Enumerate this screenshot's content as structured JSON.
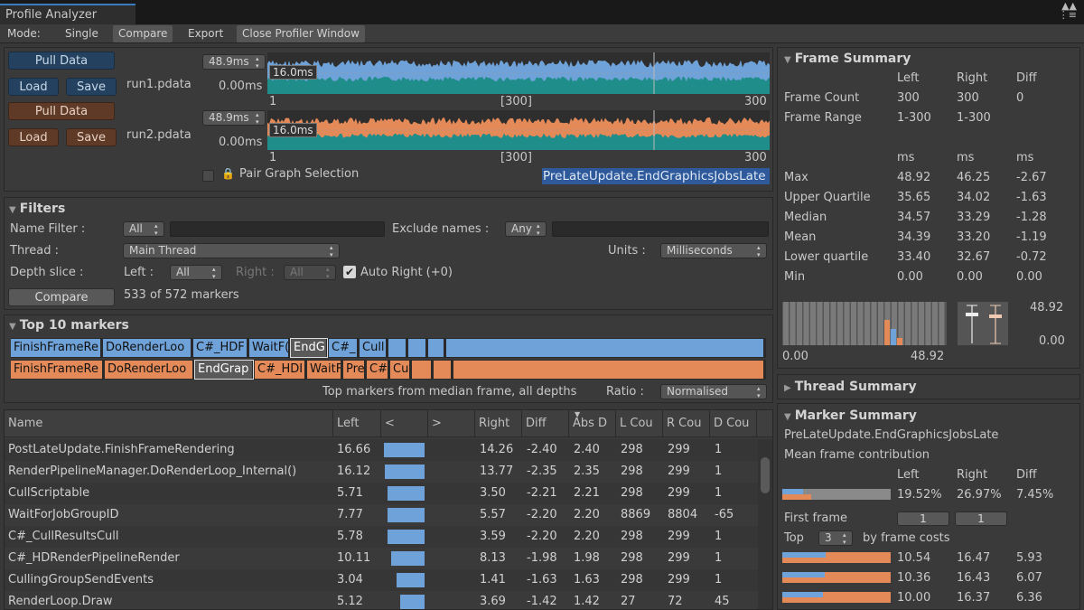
{
  "window": {
    "title": "Profile Analyzer"
  },
  "toolbar": {
    "mode_label": "Mode:",
    "single": "Single",
    "compare": "Compare",
    "export": "Export",
    "close": "Close Profiler Window"
  },
  "runs": [
    {
      "pull": "Pull Data",
      "load": "Load",
      "save": "Save",
      "name": "run1.pdata",
      "max": "48.9ms",
      "min": "0.00ms",
      "line": "16.0ms",
      "x_start": "1",
      "x_mid": "[300]",
      "x_end": "300",
      "color": "#6fa2d8"
    },
    {
      "pull": "Pull Data",
      "load": "Load",
      "save": "Save",
      "name": "run2.pdata",
      "max": "48.9ms",
      "min": "0.00ms",
      "line": "16.0ms",
      "x_start": "1",
      "x_mid": "[300]",
      "x_end": "300",
      "color": "#e38a58"
    }
  ],
  "pair_graph": "Pair Graph Selection",
  "selected_marker": "PreLateUpdate.EndGraphicsJobsLate",
  "filters": {
    "title": "Filters",
    "name_filter": "Name Filter :",
    "name_filter_value": "All",
    "exclude_names": "Exclude names :",
    "exclude_value": "Any",
    "thread": "Thread :",
    "thread_value": "Main Thread",
    "units": "Units :",
    "units_value": "Milliseconds",
    "depth": "Depth slice :",
    "left": "Left :",
    "left_value": "All",
    "right": "Right :",
    "right_value": "All",
    "auto_right": "Auto Right (+0)",
    "compare": "Compare",
    "markers_count": "533 of 572 markers"
  },
  "top10": {
    "title": "Top 10 markers",
    "row1": [
      "FinishFrameRe",
      "DoRenderLoo",
      "C#_HDF",
      "WaitF(",
      "EndG",
      "C#_",
      "Cull:",
      "",
      "",
      ""
    ],
    "row2": [
      "FinishFrameRe",
      "DoRenderLoo",
      "EndGrap",
      "C#_HDI",
      "WaitF",
      "Pre",
      "C#",
      "Cu",
      "",
      ""
    ],
    "footer": "Top markers from median frame, all depths",
    "ratio_label": "Ratio :",
    "ratio_value": "Normalised"
  },
  "table": {
    "headers": [
      "Name",
      "Left",
      "<",
      ">",
      "Right",
      "Diff",
      "Abs D",
      "L Cou",
      "R Cou",
      "D Cou"
    ],
    "rows": [
      {
        "name": "PostLateUpdate.FinishFrameRendering",
        "left": "16.66",
        "right": "14.26",
        "diff": "-2.40",
        "abs": "2.40",
        "lc": "298",
        "rc": "299",
        "dc": "1",
        "bar": 2.4
      },
      {
        "name": "RenderPipelineManager.DoRenderLoop_Internal()",
        "left": "16.12",
        "right": "13.77",
        "diff": "-2.35",
        "abs": "2.35",
        "lc": "298",
        "rc": "299",
        "dc": "1",
        "bar": 2.35
      },
      {
        "name": "CullScriptable",
        "left": "5.71",
        "right": "3.50",
        "diff": "-2.21",
        "abs": "2.21",
        "lc": "298",
        "rc": "299",
        "dc": "1",
        "bar": 2.21
      },
      {
        "name": "WaitForJobGroupID",
        "left": "7.77",
        "right": "5.57",
        "diff": "-2.20",
        "abs": "2.20",
        "lc": "8869",
        "rc": "8804",
        "dc": "-65",
        "bar": 2.2
      },
      {
        "name": "C#_CullResultsCull",
        "left": "5.78",
        "right": "3.59",
        "diff": "-2.20",
        "abs": "2.20",
        "lc": "298",
        "rc": "299",
        "dc": "1",
        "bar": 2.2
      },
      {
        "name": "C#_HDRenderPipelineRender",
        "left": "10.11",
        "right": "8.13",
        "diff": "-1.98",
        "abs": "1.98",
        "lc": "298",
        "rc": "299",
        "dc": "1",
        "bar": 1.98
      },
      {
        "name": "CullingGroupSendEvents",
        "left": "3.04",
        "right": "1.41",
        "diff": "-1.63",
        "abs": "1.63",
        "lc": "298",
        "rc": "299",
        "dc": "1",
        "bar": 1.63
      },
      {
        "name": "RenderLoop.Draw",
        "left": "5.12",
        "right": "3.69",
        "diff": "-1.42",
        "abs": "1.42",
        "lc": "27",
        "rc": "72",
        "dc": "45",
        "bar": 1.42
      }
    ]
  },
  "frame_summary": {
    "title": "Frame Summary",
    "cols": [
      "Left",
      "Right",
      "Diff"
    ],
    "frame_count": [
      "Frame Count",
      "300",
      "300",
      "0"
    ],
    "frame_range": [
      "Frame Range",
      "1-300",
      "1-300",
      ""
    ],
    "units": [
      "",
      "ms",
      "ms",
      "ms"
    ],
    "stats": [
      [
        "Max",
        "48.92",
        "46.25",
        "-2.67"
      ],
      [
        "Upper Quartile",
        "35.65",
        "34.02",
        "-1.63"
      ],
      [
        "Median",
        "34.57",
        "33.29",
        "-1.28"
      ],
      [
        "Mean",
        "34.39",
        "33.20",
        "-1.19"
      ],
      [
        "Lower quartile",
        "33.40",
        "32.67",
        "-0.72"
      ],
      [
        "Min",
        "0.00",
        "0.00",
        "0.00"
      ]
    ],
    "hist_min": "0.00",
    "hist_max": "48.92",
    "box_max": "48.92",
    "box_min": "0.00"
  },
  "thread_summary": {
    "title": "Thread Summary"
  },
  "marker_summary": {
    "title": "Marker Summary",
    "marker": "PreLateUpdate.EndGraphicsJobsLate",
    "mean_contrib": "Mean frame contribution",
    "cols": [
      "Left",
      "Right",
      "Diff"
    ],
    "contrib": [
      "19.52%",
      "26.97%",
      "7.45%"
    ],
    "first_frame": "First frame",
    "first_left": "1",
    "first_right": "1",
    "top": "Top",
    "top_n": "3",
    "by_frame": "by frame costs",
    "top_rows": [
      {
        "l": "10.54",
        "r": "16.47",
        "d": "5.93"
      },
      {
        "l": "10.36",
        "r": "16.43",
        "d": "6.07"
      },
      {
        "l": "10.00",
        "r": "16.37",
        "d": "6.36"
      }
    ]
  },
  "colors": {
    "left": "#6fa2d8",
    "right": "#e38a58",
    "teal": "#1f8d8a"
  }
}
